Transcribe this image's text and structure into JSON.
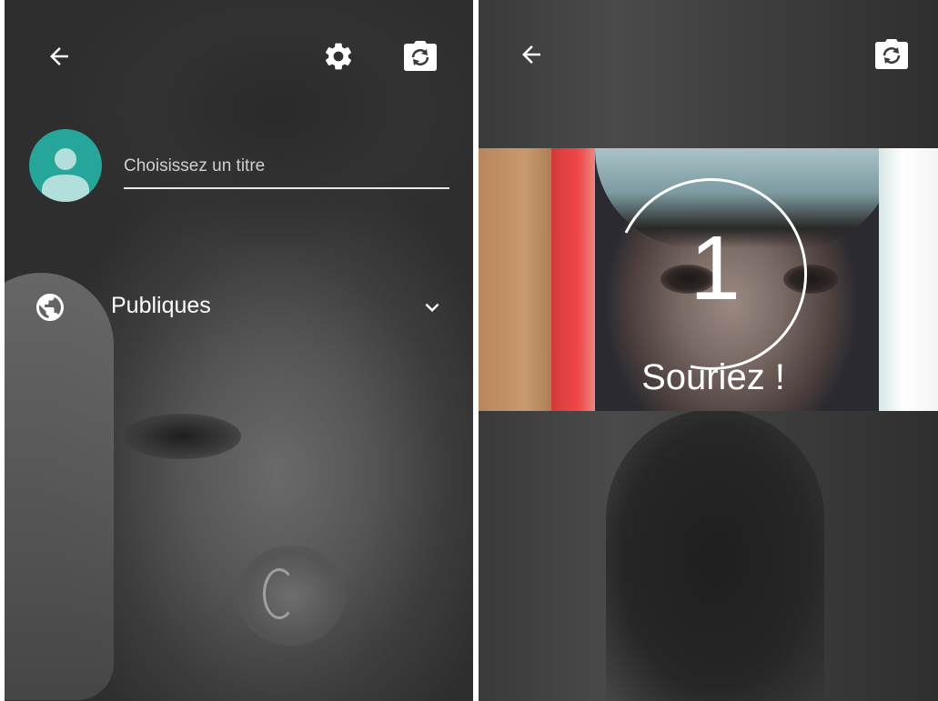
{
  "left_screen": {
    "icons": {
      "back": "arrow-back-icon",
      "settings": "gear-icon",
      "switch_camera": "switch-camera-icon",
      "avatar": "person-icon",
      "privacy": "globe-icon",
      "dropdown": "chevron-down-icon"
    },
    "title_input": {
      "placeholder": "Choisissez un titre",
      "value": ""
    },
    "privacy": {
      "selected": "Publiques"
    }
  },
  "right_screen": {
    "icons": {
      "back": "arrow-back-icon",
      "switch_camera": "switch-camera-icon"
    },
    "countdown": {
      "value": "1",
      "message": "Souriez !"
    }
  },
  "colors": {
    "avatar_bg": "#26a69a",
    "text": "#ffffff"
  }
}
